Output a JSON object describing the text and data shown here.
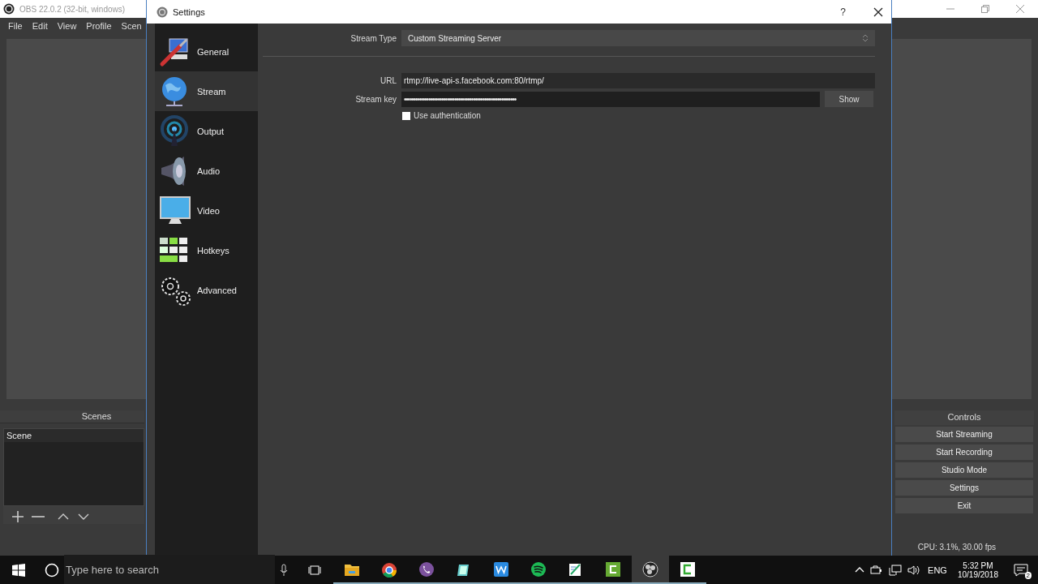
{
  "main_window": {
    "title": "OBS 22.0.2 (32-bit, windows)",
    "menu": [
      "File",
      "Edit",
      "View",
      "Profile",
      "Scen"
    ],
    "scenes_dock": {
      "title": "Scenes",
      "items": [
        "Scene"
      ]
    },
    "controls_dock": {
      "title": "Controls",
      "buttons": [
        "Start Streaming",
        "Start Recording",
        "Studio Mode",
        "Settings",
        "Exit"
      ]
    },
    "status": "CPU: 3.1%, 30.00 fps"
  },
  "settings_dialog": {
    "title": "Settings",
    "help": "?",
    "sidebar": [
      {
        "kind": "general",
        "label": "General",
        "selected": false
      },
      {
        "kind": "stream",
        "label": "Stream",
        "selected": true
      },
      {
        "kind": "output",
        "label": "Output",
        "selected": false
      },
      {
        "kind": "audio",
        "label": "Audio",
        "selected": false
      },
      {
        "kind": "video",
        "label": "Video",
        "selected": false
      },
      {
        "kind": "hotkeys",
        "label": "Hotkeys",
        "selected": false
      },
      {
        "kind": "advanced",
        "label": "Advanced",
        "selected": false
      }
    ],
    "stream": {
      "stream_type_label": "Stream Type",
      "stream_type": "Custom Streaming Server",
      "url_label": "URL",
      "url": "rtmp://live-api-s.facebook.com:80/rtmp/",
      "key_label": "Stream key",
      "key_masked": "••••••••••••••••••••••••••••••••••••••••••••••••••••••••••••",
      "show_button": "Show",
      "use_auth": {
        "label": "Use authentication",
        "checked": false
      }
    }
  },
  "taskbar": {
    "search_placeholder": "Type here to search",
    "apps": [
      {
        "kind": "explorer",
        "active": false
      },
      {
        "kind": "chrome",
        "active": false
      },
      {
        "kind": "viber",
        "active": false
      },
      {
        "kind": "pen",
        "active": false
      },
      {
        "kind": "writer",
        "active": false
      },
      {
        "kind": "spotify",
        "active": false
      },
      {
        "kind": "notes",
        "active": false
      },
      {
        "kind": "camtasia",
        "active": false
      },
      {
        "kind": "obs",
        "active": true
      },
      {
        "kind": "camtasia2",
        "active": false
      }
    ],
    "language": "ENG",
    "time": "5:32 PM",
    "date": "10/19/2018",
    "notifications": "2"
  }
}
